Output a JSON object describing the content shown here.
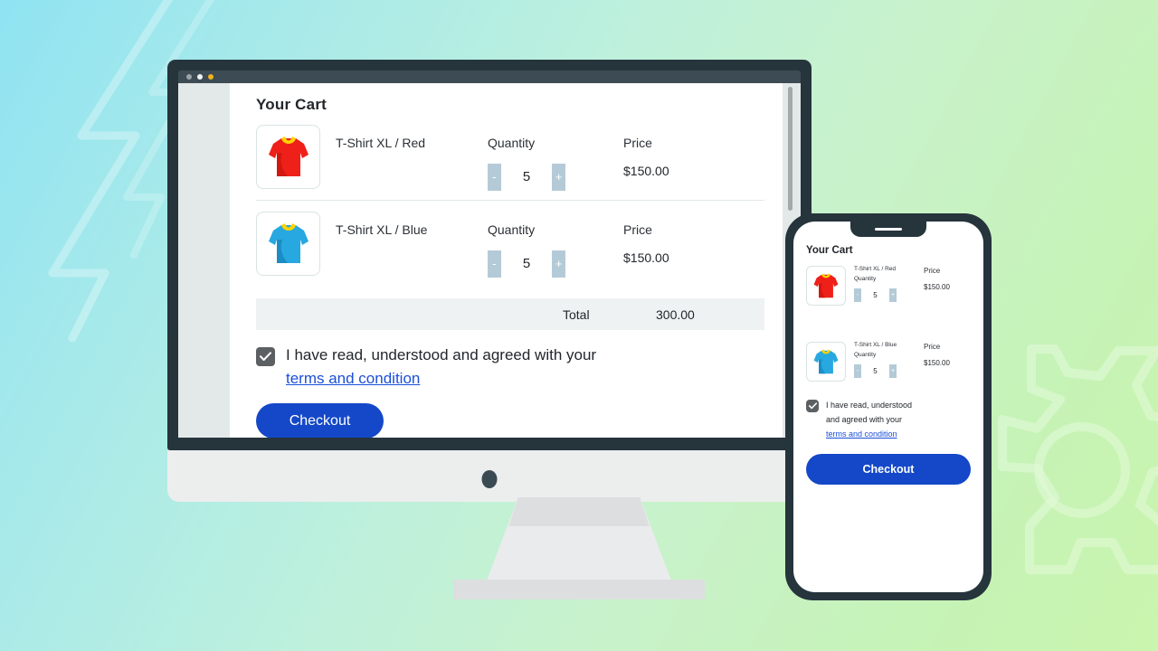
{
  "window": {
    "traffic_lights": [
      "gray",
      "white",
      "amber"
    ]
  },
  "desktop": {
    "title": "Your Cart",
    "columns": {
      "quantity": "Quantity",
      "price": "Price"
    },
    "items": [
      {
        "name": "T-Shirt XL / Red",
        "swatch": "red",
        "quantity_label": "Quantity",
        "quantity": "5",
        "decrement": "-",
        "increment": "+",
        "price_label": "Price",
        "price": "$150.00"
      },
      {
        "name": "T-Shirt XL / Blue",
        "swatch": "blue",
        "quantity_label": "Quantity",
        "quantity": "5",
        "decrement": "-",
        "increment": "+",
        "price_label": "Price",
        "price": "$150.00"
      }
    ],
    "total_label": "Total",
    "total_value": "300.00",
    "agree_text": "I have read, understood and agreed with your",
    "terms_link": "terms and condition",
    "checkout_label": "Checkout"
  },
  "mobile": {
    "title": "Your Cart",
    "items": [
      {
        "name": "T-Shirt XL / Red",
        "swatch": "red",
        "quantity_label": "Quantity",
        "quantity": "5",
        "decrement": "-",
        "increment": "+",
        "price_label": "Price",
        "price": "$150.00"
      },
      {
        "name": "T-Shirt XL / Blue",
        "swatch": "blue",
        "quantity_label": "Quantity",
        "quantity": "5",
        "decrement": "-",
        "increment": "+",
        "price_label": "Price",
        "price": "$150.00"
      }
    ],
    "agree_line1": "I have read, understood",
    "agree_line2": "and agreed with your",
    "terms_link": "terms and condition",
    "checkout_label": "Checkout"
  },
  "colors": {
    "accent_blue": "#1448c8",
    "link_blue": "#1b4fd8",
    "stepper_button": "#b4cbd7",
    "checkbox": "#5d6063",
    "bezel": "#26343c",
    "shirt_red": "#ef2019",
    "shirt_blue": "#27a8e0",
    "collar_yellow": "#ffd400",
    "total_bar": "#eef2f3",
    "bg_start": "#8fe3f2",
    "bg_end": "#c9f5ae"
  }
}
